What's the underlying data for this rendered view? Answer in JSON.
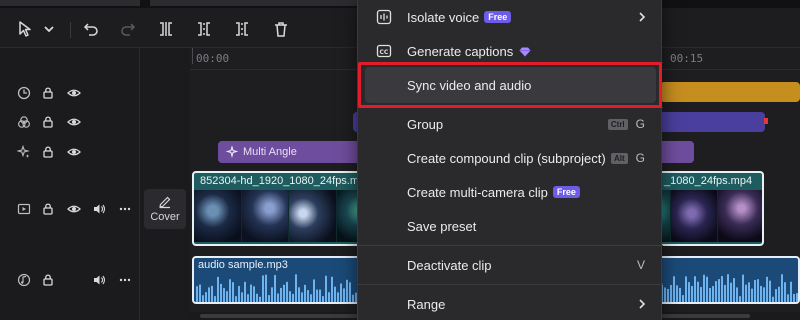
{
  "toolbar": {
    "icons": [
      "select-arrow-icon",
      "chevron-down-icon",
      "undo-icon",
      "redo-icon",
      "split-icon",
      "split-left-icon",
      "split-right-icon",
      "delete-icon"
    ]
  },
  "ruler": {
    "labels": [
      "00:00",
      "00:15"
    ]
  },
  "tracks": {
    "cover_label": "Cover",
    "multi_angle_label": "Multi Angle",
    "video_clip_title": "852304-hd_1920_1080_24fps.mp4",
    "video_clip_title_right": "_1080_24fps.mp4",
    "audio_clip_title": "audio sample.mp3"
  },
  "menu": {
    "items": [
      {
        "label": "Isolate voice",
        "badge": "Free",
        "icon": "isolate-voice-icon",
        "submenu": true
      },
      {
        "label": "Generate captions",
        "icon": "captions-icon",
        "premium_icon": "diamond-icon"
      },
      {
        "label": "Sync video and audio"
      },
      {
        "label": "Group",
        "shortcut_key": "Ctrl",
        "shortcut": "G"
      },
      {
        "label": "Create compound clip (subproject)",
        "shortcut_key": "Alt",
        "shortcut": "G"
      },
      {
        "label": "Create multi-camera clip",
        "badge": "Free"
      },
      {
        "label": "Save preset"
      },
      {
        "label": "Deactivate clip",
        "shortcut": "V"
      },
      {
        "label": "Range",
        "submenu": true
      }
    ]
  },
  "colors": {
    "accent_badge": "#6c5ce7",
    "highlight_box": "#e11d2b",
    "video_clip": "#1f5c60",
    "audio_clip": "#1b4a79",
    "multi_angle_clip": "#6f4d9e",
    "text_track": "#4a3f9e",
    "effect_track": "#c68d1f"
  }
}
